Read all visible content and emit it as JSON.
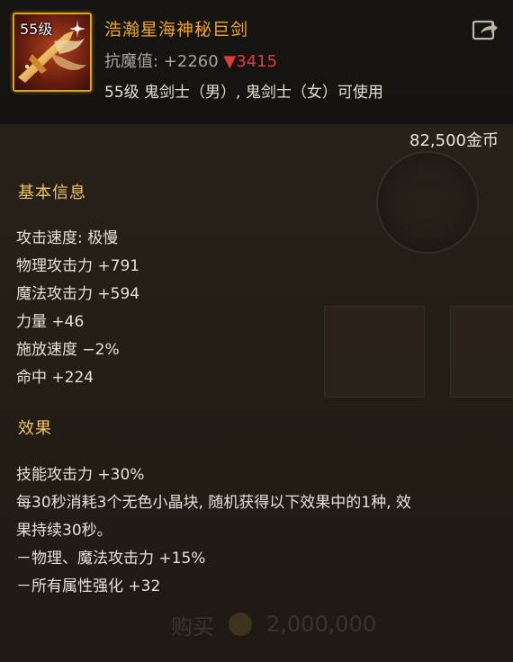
{
  "item": {
    "level_badge": "55级",
    "name": "浩瀚星海神秘巨剑",
    "resist_label": "抗魔值: +2260",
    "resist_down": "3415",
    "usable_by": "55级 鬼剑士（男）, 鬼剑士（女）可使用",
    "price": "82,500金币"
  },
  "basic": {
    "title": "基本信息",
    "stats": [
      "攻击速度: 极慢",
      "物理攻击力 +791",
      "魔法攻击力 +594",
      "力量 +46",
      "施放速度 −2%",
      "命中 +224"
    ]
  },
  "effect": {
    "title": "效果",
    "lines": [
      "技能攻击力 +30%",
      "每30秒消耗3个无色小晶块, 随机获得以下效果中的1种, 效",
      "果持续30秒。",
      "－物理、魔法攻击力 +15%",
      "－所有属性强化 +32"
    ]
  },
  "background": {
    "footer_price": "2,000,000",
    "footer_label": "购买"
  },
  "colors": {
    "item_name": "#f2a51c",
    "section_title": "#f0c460",
    "resist_down": "#e23b3b"
  }
}
